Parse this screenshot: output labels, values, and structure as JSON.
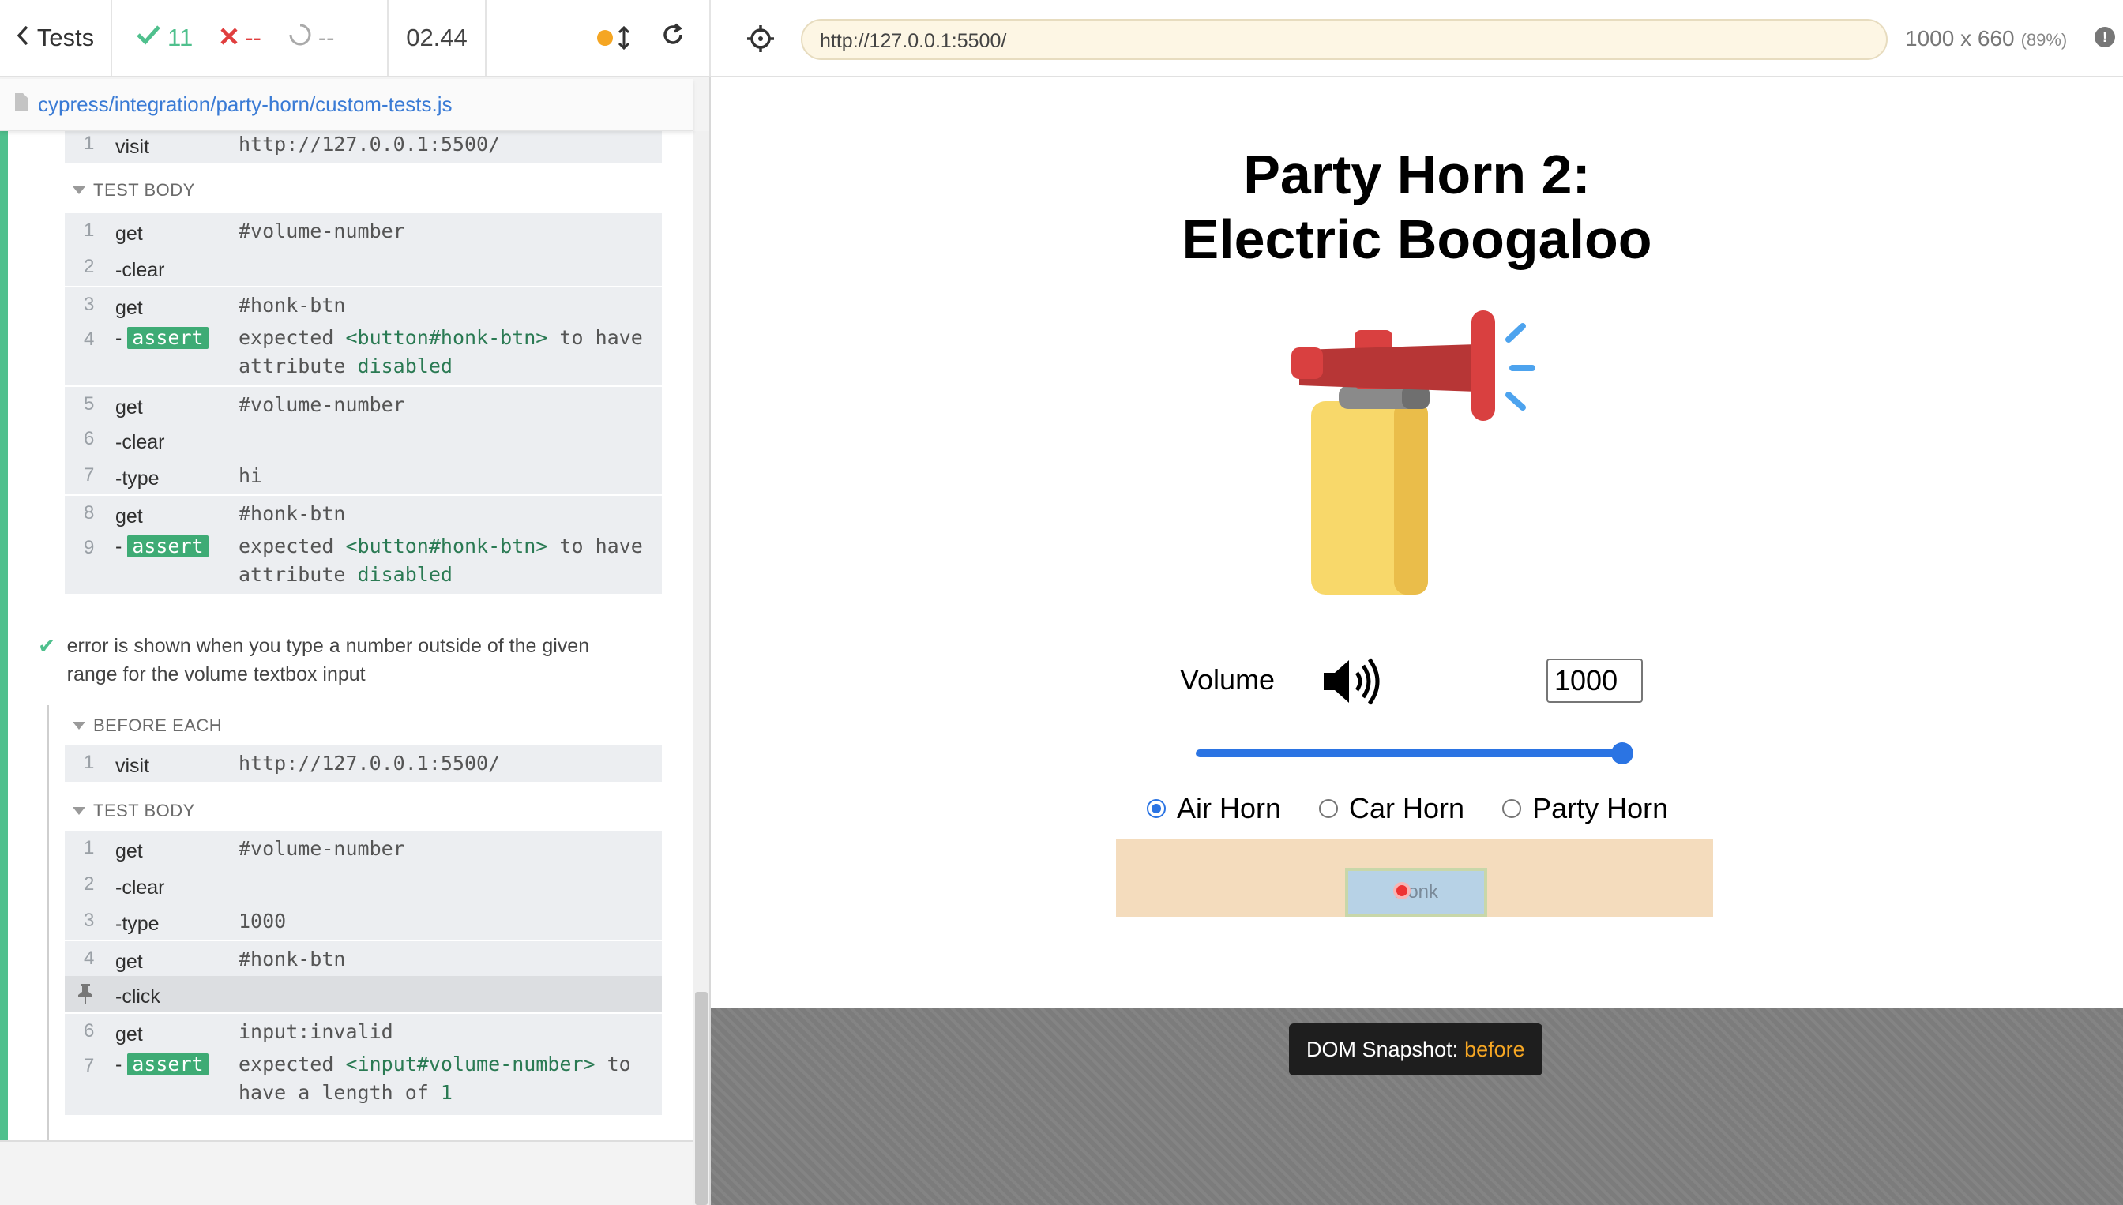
{
  "reporter": {
    "tests_label": "Tests",
    "passed": "11",
    "failed": "--",
    "pending": "--",
    "duration": "02.44",
    "spec_path": "cypress/integration/party-horn/custom-tests.js"
  },
  "prev_test": {
    "before_each": [
      {
        "num": "1",
        "cmd": "visit",
        "arg": "http://127.0.0.1:5500/"
      }
    ],
    "test_body_label": "TEST BODY",
    "test_body": [
      {
        "num": "1",
        "cmd": "get",
        "arg": "#volume-number"
      },
      {
        "num": "2",
        "cmd": "-clear",
        "arg": ""
      },
      {
        "num": "3",
        "cmd": "get",
        "arg": "#honk-btn"
      },
      {
        "num": "4",
        "cmd": "assert",
        "expected": "expected",
        "subject": "<button#honk-btn>",
        "mid": "to have\nattribute",
        "value": "disabled"
      },
      {
        "num": "5",
        "cmd": "get",
        "arg": "#volume-number"
      },
      {
        "num": "6",
        "cmd": "-clear",
        "arg": ""
      },
      {
        "num": "7",
        "cmd": "-type",
        "arg": "hi"
      },
      {
        "num": "8",
        "cmd": "get",
        "arg": "#honk-btn"
      },
      {
        "num": "9",
        "cmd": "assert",
        "expected": "expected",
        "subject": "<button#honk-btn>",
        "mid": "to have\nattribute",
        "value": "disabled"
      }
    ]
  },
  "current_test": {
    "title": "error is shown when you type a number outside of the given range for the volume textbox input",
    "before_each_label": "BEFORE EACH",
    "before_each": [
      {
        "num": "1",
        "cmd": "visit",
        "arg": "http://127.0.0.1:5500/"
      }
    ],
    "test_body_label": "TEST BODY",
    "test_body": [
      {
        "num": "1",
        "cmd": "get",
        "arg": "#volume-number"
      },
      {
        "num": "2",
        "cmd": "-clear",
        "arg": ""
      },
      {
        "num": "3",
        "cmd": "-type",
        "arg": "1000"
      },
      {
        "num": "4",
        "cmd": "get",
        "arg": "#honk-btn"
      },
      {
        "num": "",
        "cmd": "-click",
        "arg": ""
      },
      {
        "num": "6",
        "cmd": "get",
        "arg": "input:invalid"
      },
      {
        "num": "7",
        "cmd": "assert",
        "expected": "expected",
        "subject": "<input#volume-number>",
        "mid": "to\nhave a length of",
        "value": "1"
      }
    ]
  },
  "aut": {
    "url": "http://127.0.0.1:5500/",
    "viewport": "1000 x 660",
    "scale": "(89%)",
    "snapshot_label": "DOM Snapshot:",
    "snapshot_state": "before"
  },
  "app": {
    "title_line1": "Party Horn 2:",
    "title_line2": "Electric Boogaloo",
    "volume_label": "Volume",
    "volume_value": "1000",
    "slider_fraction": 1.0,
    "horn_options": [
      "Air Horn",
      "Car Horn",
      "Party Horn"
    ],
    "selected_horn": "Air Horn",
    "honk_label": "Honk"
  },
  "colors": {
    "pass": "#4fc08d",
    "fail": "#e03e3e",
    "accent": "#2b74e3",
    "assert": "#3eab75"
  }
}
